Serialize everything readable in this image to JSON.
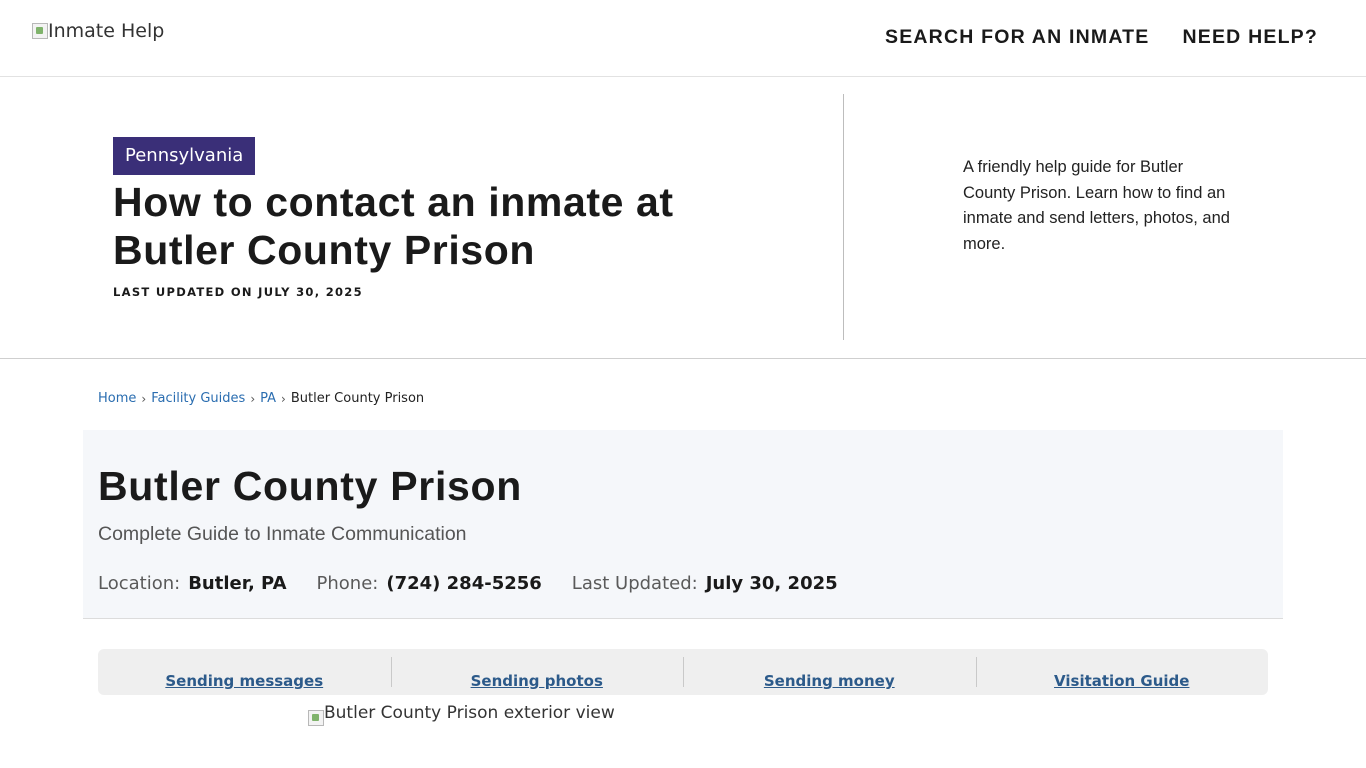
{
  "header": {
    "logo_alt": "Inmate Help",
    "nav": {
      "search": "SEARCH FOR AN INMATE",
      "help": "NEED HELP?"
    }
  },
  "hero": {
    "state_badge": "Pennsylvania",
    "title": "How to contact an inmate at Butler County Prison",
    "updated": "LAST UPDATED ON JULY 30, 2025",
    "description": "A friendly help guide for Butler County Prison. Learn how to find an inmate and send letters, photos, and more."
  },
  "breadcrumb": {
    "items": [
      "Home",
      "Facility Guides",
      "PA"
    ],
    "current": "Butler County Prison",
    "separator": "›"
  },
  "facility": {
    "title": "Butler County Prison",
    "subtitle": "Complete Guide to Inmate Communication",
    "location_label": "Location:",
    "location_value": "Butler, PA",
    "phone_label": "Phone:",
    "phone_value": "(724) 284-5256",
    "updated_label": "Last Updated:",
    "updated_value": "July 30, 2025"
  },
  "tabs": [
    "Sending messages",
    "Sending photos",
    "Sending money",
    "Visitation Guide"
  ],
  "exterior_image_alt": "Butler County Prison exterior view",
  "colors": {
    "badge_bg": "#3a2f78",
    "link": "#2a6db0",
    "tab_link": "#2c5a8a",
    "card_bg": "#f5f7fa"
  }
}
